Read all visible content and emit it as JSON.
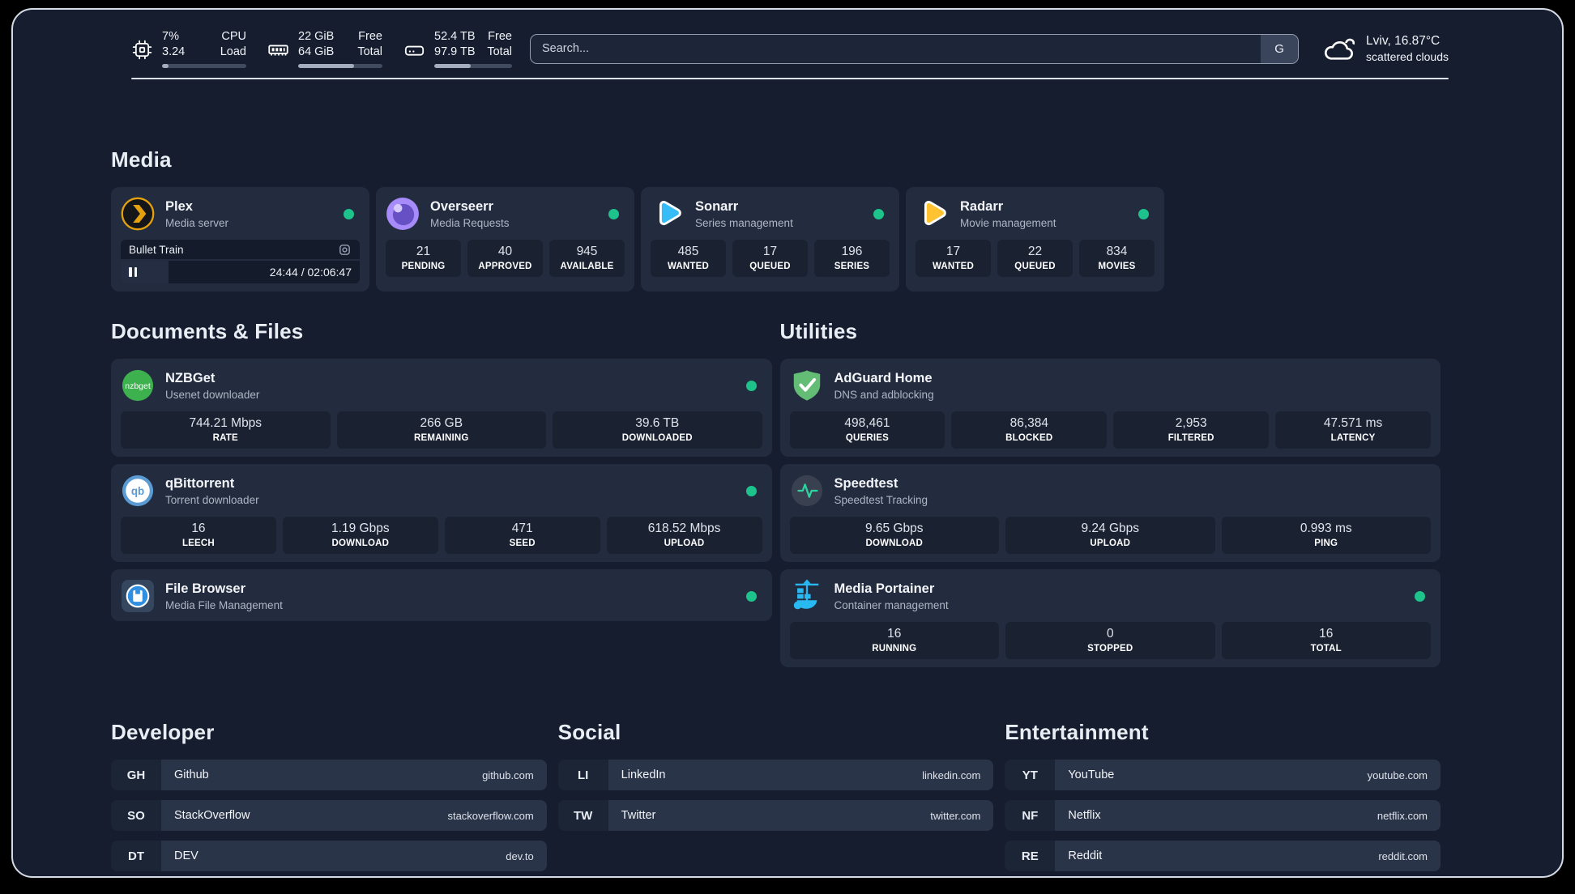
{
  "colors": {
    "status": "#1ec28b",
    "plex": "#e5a00d",
    "sonarr": "#36bcf6",
    "radarr": "#ffc230",
    "nzbget": "#3db14d",
    "qbittorrent": "#5b9bd3",
    "adguard": "#63bd74",
    "speedtest": "#2dd4a0",
    "portainer": "#29b9f2",
    "filebrowser": "#2f8fe0",
    "overseerr_light": "#a78bfa",
    "overseerr_dark": "#6650c4"
  },
  "header": {
    "resources": {
      "cpu": {
        "value_top": "7%",
        "value_bottom": "3.24",
        "label_top": "CPU",
        "label_bottom": "Load",
        "progress_pct": 8
      },
      "memory": {
        "value_top": "22 GiB",
        "value_bottom": "64 GiB",
        "label_top": "Free",
        "label_bottom": "Total",
        "progress_pct": 66
      },
      "disk": {
        "value_top": "52.4 TB",
        "value_bottom": "97.9 TB",
        "label_top": "Free",
        "label_bottom": "Total",
        "progress_pct": 47
      }
    },
    "search": {
      "placeholder": "Search...",
      "engine_button": "G"
    },
    "weather": {
      "location_temp": "Lviv, 16.87°C",
      "condition": "scattered clouds"
    }
  },
  "media": {
    "title": "Media",
    "plex": {
      "name": "Plex",
      "description": "Media server",
      "now_playing": {
        "title": "Bullet Train",
        "time": "24:44 / 02:06:47",
        "progress_pct": 20
      }
    },
    "overseerr": {
      "name": "Overseerr",
      "description": "Media Requests",
      "stats": [
        {
          "value": "21",
          "label": "PENDING"
        },
        {
          "value": "40",
          "label": "APPROVED"
        },
        {
          "value": "945",
          "label": "AVAILABLE"
        }
      ]
    },
    "sonarr": {
      "name": "Sonarr",
      "description": "Series management",
      "stats": [
        {
          "value": "485",
          "label": "WANTED"
        },
        {
          "value": "17",
          "label": "QUEUED"
        },
        {
          "value": "196",
          "label": "SERIES"
        }
      ]
    },
    "radarr": {
      "name": "Radarr",
      "description": "Movie management",
      "stats": [
        {
          "value": "17",
          "label": "WANTED"
        },
        {
          "value": "22",
          "label": "QUEUED"
        },
        {
          "value": "834",
          "label": "MOVIES"
        }
      ]
    }
  },
  "documents": {
    "title": "Documents & Files",
    "nzbget": {
      "name": "NZBGet",
      "description": "Usenet downloader",
      "icon_text": "nzbget",
      "stats": [
        {
          "value": "744.21 Mbps",
          "label": "RATE"
        },
        {
          "value": "266 GB",
          "label": "REMAINING"
        },
        {
          "value": "39.6 TB",
          "label": "DOWNLOADED"
        }
      ]
    },
    "qbittorrent": {
      "name": "qBittorrent",
      "description": "Torrent downloader",
      "icon_text": "qb",
      "stats": [
        {
          "value": "16",
          "label": "LEECH"
        },
        {
          "value": "1.19 Gbps",
          "label": "DOWNLOAD"
        },
        {
          "value": "471",
          "label": "SEED"
        },
        {
          "value": "618.52 Mbps",
          "label": "UPLOAD"
        }
      ]
    },
    "filebrowser": {
      "name": "File Browser",
      "description": "Media File Management"
    }
  },
  "utilities": {
    "title": "Utilities",
    "adguard": {
      "name": "AdGuard Home",
      "description": "DNS and adblocking",
      "stats": [
        {
          "value": "498,461",
          "label": "QUERIES"
        },
        {
          "value": "86,384",
          "label": "BLOCKED"
        },
        {
          "value": "2,953",
          "label": "FILTERED"
        },
        {
          "value": "47.571 ms",
          "label": "LATENCY"
        }
      ]
    },
    "speedtest": {
      "name": "Speedtest",
      "description": "Speedtest Tracking",
      "stats": [
        {
          "value": "9.65 Gbps",
          "label": "DOWNLOAD"
        },
        {
          "value": "9.24 Gbps",
          "label": "UPLOAD"
        },
        {
          "value": "0.993 ms",
          "label": "PING"
        }
      ]
    },
    "portainer": {
      "name": "Media Portainer",
      "description": "Container management",
      "stats": [
        {
          "value": "16",
          "label": "RUNNING"
        },
        {
          "value": "0",
          "label": "STOPPED"
        },
        {
          "value": "16",
          "label": "TOTAL"
        }
      ]
    }
  },
  "bookmarks": [
    {
      "title": "Developer",
      "links": [
        {
          "abbr": "GH",
          "name": "Github",
          "url": "github.com"
        },
        {
          "abbr": "SO",
          "name": "StackOverflow",
          "url": "stackoverflow.com"
        },
        {
          "abbr": "DT",
          "name": "DEV",
          "url": "dev.to"
        }
      ]
    },
    {
      "title": "Social",
      "links": [
        {
          "abbr": "LI",
          "name": "LinkedIn",
          "url": "linkedin.com"
        },
        {
          "abbr": "TW",
          "name": "Twitter",
          "url": "twitter.com"
        }
      ]
    },
    {
      "title": "Entertainment",
      "links": [
        {
          "abbr": "YT",
          "name": "YouTube",
          "url": "youtube.com"
        },
        {
          "abbr": "NF",
          "name": "Netflix",
          "url": "netflix.com"
        },
        {
          "abbr": "RE",
          "name": "Reddit",
          "url": "reddit.com"
        }
      ]
    }
  ]
}
